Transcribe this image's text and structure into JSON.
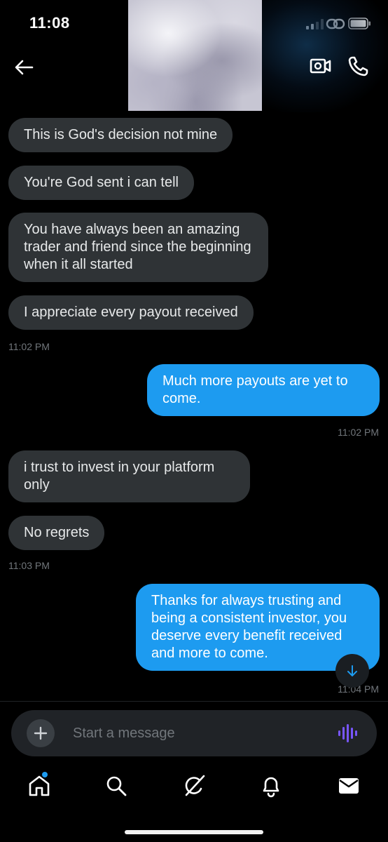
{
  "status_bar": {
    "time": "11:08"
  },
  "colors": {
    "incoming_bubble": "#2f3336",
    "outgoing_bubble": "#1d9bf0",
    "timestamp": "#71767b",
    "accent": "#1d9bf0"
  },
  "header": {
    "icons": [
      "back-arrow-icon",
      "video-call-icon",
      "phone-icon"
    ]
  },
  "messages": [
    {
      "dir": "in",
      "text": "This is God's decision not mine"
    },
    {
      "dir": "in",
      "text": "You're God sent i can tell"
    },
    {
      "dir": "in",
      "text": "You have always been an amazing trader and friend since the beginning when it all started"
    },
    {
      "dir": "in",
      "text": "I appreciate every payout received",
      "time": "11:02 PM"
    },
    {
      "dir": "out",
      "text": "Much more payouts are yet to come.",
      "time": "11:02 PM"
    },
    {
      "dir": "in",
      "text": "i trust to invest in your platform only"
    },
    {
      "dir": "in",
      "text": "No regrets",
      "time": "11:03 PM"
    },
    {
      "dir": "out",
      "text": "Thanks for always trusting and being a consistent investor, you deserve every benefit received and more to come.",
      "time": "11:04 PM"
    }
  ],
  "composer": {
    "placeholder": "Start a message"
  },
  "tab_bar": {
    "items": [
      "home-icon",
      "search-icon",
      "grok-icon",
      "notifications-icon",
      "messages-icon"
    ]
  }
}
